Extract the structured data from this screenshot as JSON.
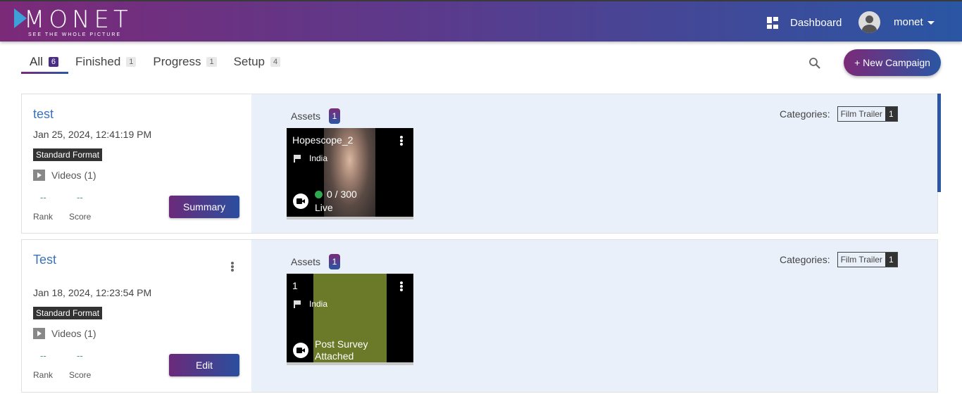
{
  "brand": {
    "logo_text": "MONET",
    "tagline": "SEE THE WHOLE PICTURE"
  },
  "header": {
    "dashboard_label": "Dashboard",
    "username": "monet"
  },
  "tabs": [
    {
      "label": "All",
      "count": "6",
      "active": true
    },
    {
      "label": "Finished",
      "count": "1"
    },
    {
      "label": "Progress",
      "count": "1"
    },
    {
      "label": "Setup",
      "count": "4"
    }
  ],
  "toolbar": {
    "new_campaign_label": "+ New Campaign"
  },
  "campaigns": [
    {
      "title": "test",
      "date": "Jan 25, 2024, 12:41:19 PM",
      "format": "Standard Format",
      "videos": "Videos (1)",
      "rank_value": "--",
      "score_value": "--",
      "rank_label": "Rank",
      "score_label": "Score",
      "action_label": "Summary",
      "assets_label": "Assets",
      "assets_count": "1",
      "categories_label": "Categories:",
      "category_name": "Film Trailer",
      "category_count": "1",
      "asset": {
        "name": "Hopescope_2",
        "country": "India",
        "progress": "0 / 300",
        "status": "Live"
      }
    },
    {
      "title": "Test",
      "date": "Jan 18, 2024, 12:23:54 PM",
      "format": "Standard Format",
      "videos": "Videos (1)",
      "rank_value": "--",
      "score_value": "--",
      "rank_label": "Rank",
      "score_label": "Score",
      "action_label": "Edit",
      "assets_label": "Assets",
      "assets_count": "1",
      "categories_label": "Categories:",
      "category_name": "Film Trailer",
      "category_count": "1",
      "asset": {
        "name": "1",
        "country": "India",
        "status": "Post Survey Attached"
      }
    }
  ],
  "colors": {
    "brand_gradient_start": "#7b2a78",
    "brand_gradient_end": "#2a56a3",
    "link_blue": "#3b73b9",
    "panel_bg": "#eaf0f9",
    "live_green": "#2fa84f"
  }
}
